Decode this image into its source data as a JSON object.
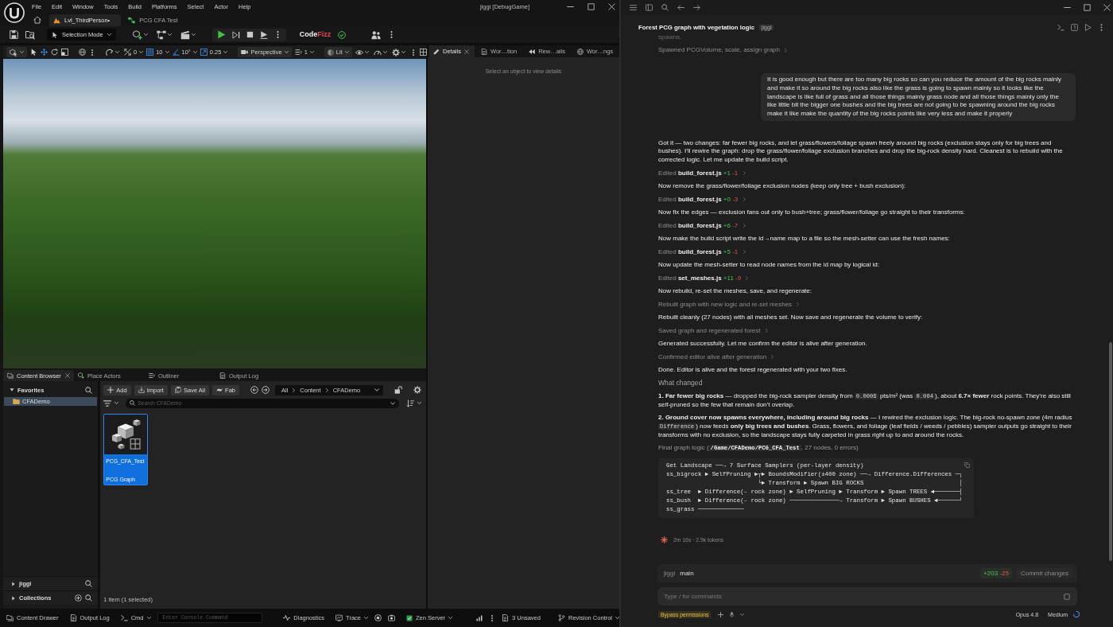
{
  "editor": {
    "menu": [
      "File",
      "Edit",
      "Window",
      "Tools",
      "Build",
      "Platforms",
      "Select",
      "Actor",
      "Help"
    ],
    "window_title": "jiggi [DebugGame]",
    "document_tabs": [
      {
        "label": "Lvl_ThirdPerson•",
        "selected": true
      },
      {
        "label": "PCG CFA Test",
        "selected": false
      }
    ],
    "toolbar": {
      "mode": "Selection Mode",
      "plugin_logo": {
        "first": "Code",
        "second": "Fizz"
      }
    },
    "viewport_toolbar": {
      "transform_tools": [
        {
          "selected": false
        },
        {
          "selected": true
        },
        {
          "selected": false
        },
        {
          "selected": false
        }
      ],
      "snap_values": [
        "0",
        "10",
        "10°",
        "0.25"
      ],
      "view": "Perspective",
      "view_option": "1",
      "view_mode": "Lit"
    },
    "details": {
      "tabs": [
        {
          "label": "Details",
          "selected": true
        },
        {
          "label": "Wor…tion",
          "selected": false
        },
        {
          "label": "Rew…ails",
          "selected": false
        },
        {
          "label": "Wor…ngs",
          "selected": false
        }
      ],
      "empty_message": "Select an object to view details"
    },
    "dock_tabs": [
      {
        "label": "Content Browser",
        "selected": true
      },
      {
        "label": "Place Actors",
        "selected": false
      },
      {
        "label": "Outliner",
        "selected": false
      },
      {
        "label": "Output Log",
        "selected": false
      }
    ],
    "content_browser": {
      "favorites": {
        "label": "Favorites",
        "expanded": true,
        "folders": [
          {
            "label": "CFADemo",
            "selected": true
          }
        ]
      },
      "sections": [
        {
          "label": "jiggi",
          "expanded": false
        },
        {
          "label": "Collections",
          "expanded": false
        }
      ],
      "buttons": [
        "Add",
        "Import",
        "Save All",
        "Fab"
      ],
      "path": [
        "All",
        "Content",
        "CFADemo"
      ],
      "search": {
        "placeholder": "Search CFADemo"
      },
      "assets": [
        {
          "name": "PCG_CFA_Test",
          "type": "PCG Graph",
          "selected": true
        }
      ],
      "summary": "1 item (1 selected)"
    },
    "status_bar": {
      "content_drawer": "Content Drawer",
      "output_log": "Output Log",
      "console_mode": "Cmd",
      "console": {
        "placeholder": "Enter Console Command"
      },
      "diagnostics": "Diagnostics",
      "trace": "Trace",
      "server": "Zen Server",
      "unsaved": "3 Unsaved",
      "revision_control": "Revision Control"
    }
  },
  "assistant": {
    "title": "Forest PCG graph with vegetation logic",
    "project_tag": "jiggi",
    "messages": [
      {
        "kind": "faded",
        "text": "spawns."
      },
      {
        "kind": "step",
        "text": "Spawned PCGVolume, scale, assign graph"
      },
      {
        "kind": "user",
        "text": "It is good enough but there are too many big rocks so can you reduce the amount of the big rocks mainly and make it so around the big rocks also like the grass is going to spawn mainly so it looks like the landscape is like full of grass and all those things mainly grass node and all those things mainly only the like little bit the bigger one bushes and the big trees are not going to be spawning around the big rocks make it like make the quantity of the big rocks points like very less and make it properly"
      },
      {
        "kind": "text",
        "text": "Got it — two changes: far fewer big rocks, and let grass/flowers/foliage spawn freely around big rocks (exclusion stays only for big trees and bushes). I’ll rewire the graph: drop the grass/flower/foliage exclusion branches and drop the big-rock density hard. Cleanest is to rebuild with the corrected logic. Let me update the build script."
      },
      {
        "kind": "edit",
        "action": "Edited",
        "file": "build_forest.js",
        "added": "+1",
        "removed": "-1"
      },
      {
        "kind": "text",
        "text": "Now remove the grass/flower/foliage exclusion nodes (keep only tree + bush exclusion):"
      },
      {
        "kind": "edit",
        "action": "Edited",
        "file": "build_forest.js",
        "added": "+0",
        "removed": "-3"
      },
      {
        "kind": "text",
        "text": "Now fix the edges — exclusion fans out only to bush+tree; grass/flower/foliage go straight to their transforms:"
      },
      {
        "kind": "edit",
        "action": "Edited",
        "file": "build_forest.js",
        "added": "+6",
        "removed": "-7"
      },
      {
        "kind": "text",
        "text": "Now make the build script write the id→name map to a file so the mesh-setter can use the fresh names:"
      },
      {
        "kind": "edit",
        "action": "Edited",
        "file": "build_forest.js",
        "added": "+5",
        "removed": "-1"
      },
      {
        "kind": "text",
        "text": "Now update the mesh-setter to read node names from the id map by logical id:"
      },
      {
        "kind": "edit",
        "action": "Edited",
        "file": "set_meshes.js",
        "added": "+11",
        "removed": "-9"
      },
      {
        "kind": "text",
        "text": "Now rebuild, re-set the meshes, save, and regenerate:"
      },
      {
        "kind": "step",
        "text": "Rebuilt graph with new logic and re-set meshes"
      },
      {
        "kind": "text",
        "text": "Rebuilt cleanly (27 nodes) with all meshes set. Now save and regenerate the volume to verify:"
      },
      {
        "kind": "step",
        "text": "Saved graph and regenerated forest"
      },
      {
        "kind": "text",
        "text": "Generated successfully. Let me confirm the editor is alive after generation."
      },
      {
        "kind": "step",
        "text": "Confirmed editor alive after generation"
      },
      {
        "kind": "text",
        "text": "Done. Editor is alive and the forest regenerated with your two fixes."
      },
      {
        "kind": "heading",
        "text": "What changed"
      },
      {
        "kind": "rich",
        "segments": [
          {
            "kind": "bold",
            "text": "1. Far fewer big rocks"
          },
          {
            "kind": "plain",
            "text": " — dropped the big-rock sampler density from "
          },
          {
            "kind": "code",
            "text": "0.0006"
          },
          {
            "kind": "plain",
            "text": " pts/m² (was "
          },
          {
            "kind": "code",
            "text": "0.004"
          },
          {
            "kind": "plain",
            "text": "), about "
          },
          {
            "kind": "bold",
            "text": "6.7× fewer"
          },
          {
            "kind": "plain",
            "text": " rock points. They’re also still self-pruned so the few that remain don’t overlap."
          }
        ]
      },
      {
        "kind": "rich",
        "segments": [
          {
            "kind": "bold",
            "text": "2. Ground cover now spawns everywhere, including around big rocks"
          },
          {
            "kind": "plain",
            "text": " — I rewired the exclusion logic. The big-rock no-spawn zone (4m radius "
          },
          {
            "kind": "code",
            "text": "Difference"
          },
          {
            "kind": "plain",
            "text": ") now feeds "
          },
          {
            "kind": "bold",
            "text": "only big trees and bushes"
          },
          {
            "kind": "plain",
            "text": ". Grass, flowers, and foliage (leaf fields / weeds / pebbles) sampler outputs go straight to their transforms with no exclusion, so the landscape stays fully carpeted in grass right up to and around the rocks."
          }
        ]
      },
      {
        "kind": "note",
        "segments": [
          {
            "kind": "plain",
            "text": "Final graph logic ("
          },
          {
            "kind": "code",
            "text": "/Game/CFADemo/PCG_CFA_Test"
          },
          {
            "kind": "plain",
            "text": ", 27 nodes, 0 errors)"
          }
        ]
      },
      {
        "kind": "code",
        "lines": [
          "Get Landscape ──→ 7 Surface Samplers (per-layer density)",
          "ss_bigrock ► SelfPruning ►┬► BoundsModifier(±400 zone) ──→ Difference.Differences ─┐",
          "                          └► Transform ► Spawn BIG ROCKS                           │",
          "ss_tree  ► Difference(- rock zone) ► SelfPruning ► Transform ► Spawn TREES ◄───────┤",
          "ss_bush  ► Difference(- rock zone) ──────────────→ Transform ► Spawn BUSHES ◄──────┘",
          "ss_grass ─────────────"
        ]
      }
    ],
    "run_stats": "2m 16s · 2.9k tokens",
    "git": {
      "repo": "jiggi",
      "branch": "main",
      "added": "+203",
      "removed": "-25",
      "commit": {
        "label": "Commit changes",
        "disabled": true
      }
    },
    "composer": {
      "placeholder": "Type / for commands"
    },
    "footer": {
      "permission_mode": "Bypass permissions",
      "model": "Opus 4.8",
      "effort": "Medium"
    }
  }
}
